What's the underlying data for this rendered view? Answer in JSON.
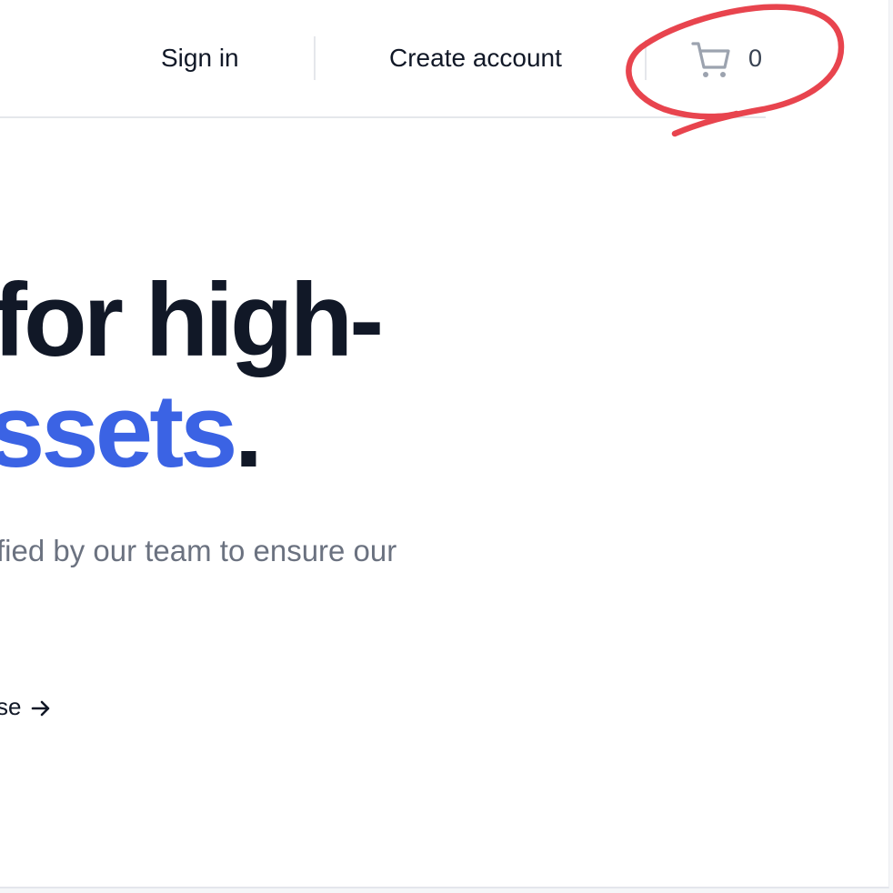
{
  "header": {
    "sign_in_label": "Sign in",
    "create_account_label": "Create account",
    "cart_count": "0"
  },
  "hero": {
    "line1": "for high-",
    "line2_accent": "ssets",
    "line2_period": ".",
    "subtitle": "fied by our team to ensure our",
    "cta_label": "se"
  },
  "icons": {
    "cart": "shopping-cart-icon",
    "cta_arrow": "arrow-right-icon"
  },
  "colors": {
    "heading": "#111827",
    "accent": "#3b63e4",
    "muted": "#6b7280",
    "annotation": "#e8444e"
  }
}
